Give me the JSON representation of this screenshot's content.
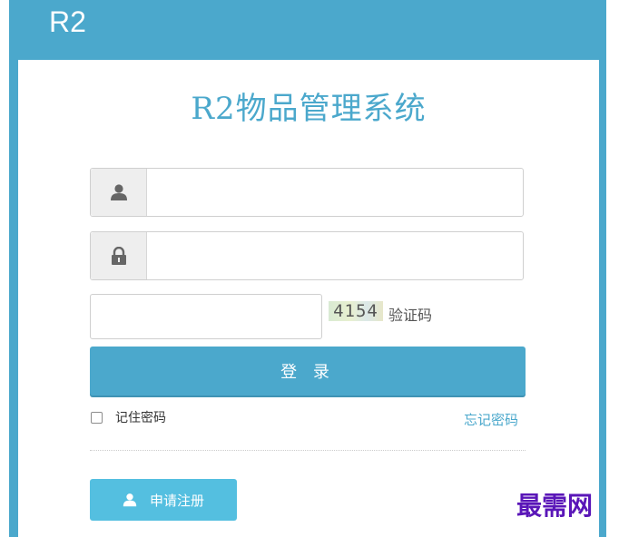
{
  "header": {
    "brand": "R2"
  },
  "login": {
    "title": "R2物品管理系统",
    "username": {
      "value": "",
      "placeholder": "",
      "icon": "user-icon"
    },
    "password": {
      "value": "",
      "placeholder": "",
      "icon": "lock-icon"
    },
    "captcha": {
      "value": "",
      "image_text": "4154",
      "label": "验证码"
    },
    "submit_label": "登 录",
    "remember_label": "记住密码",
    "remember_checked": false,
    "forgot_label": "忘记密码",
    "register_label": "申请注册"
  },
  "watermark": "最需网",
  "colors": {
    "accent": "#4ba8cc",
    "register": "#54bfe0",
    "watermark": "#5a16b8"
  }
}
